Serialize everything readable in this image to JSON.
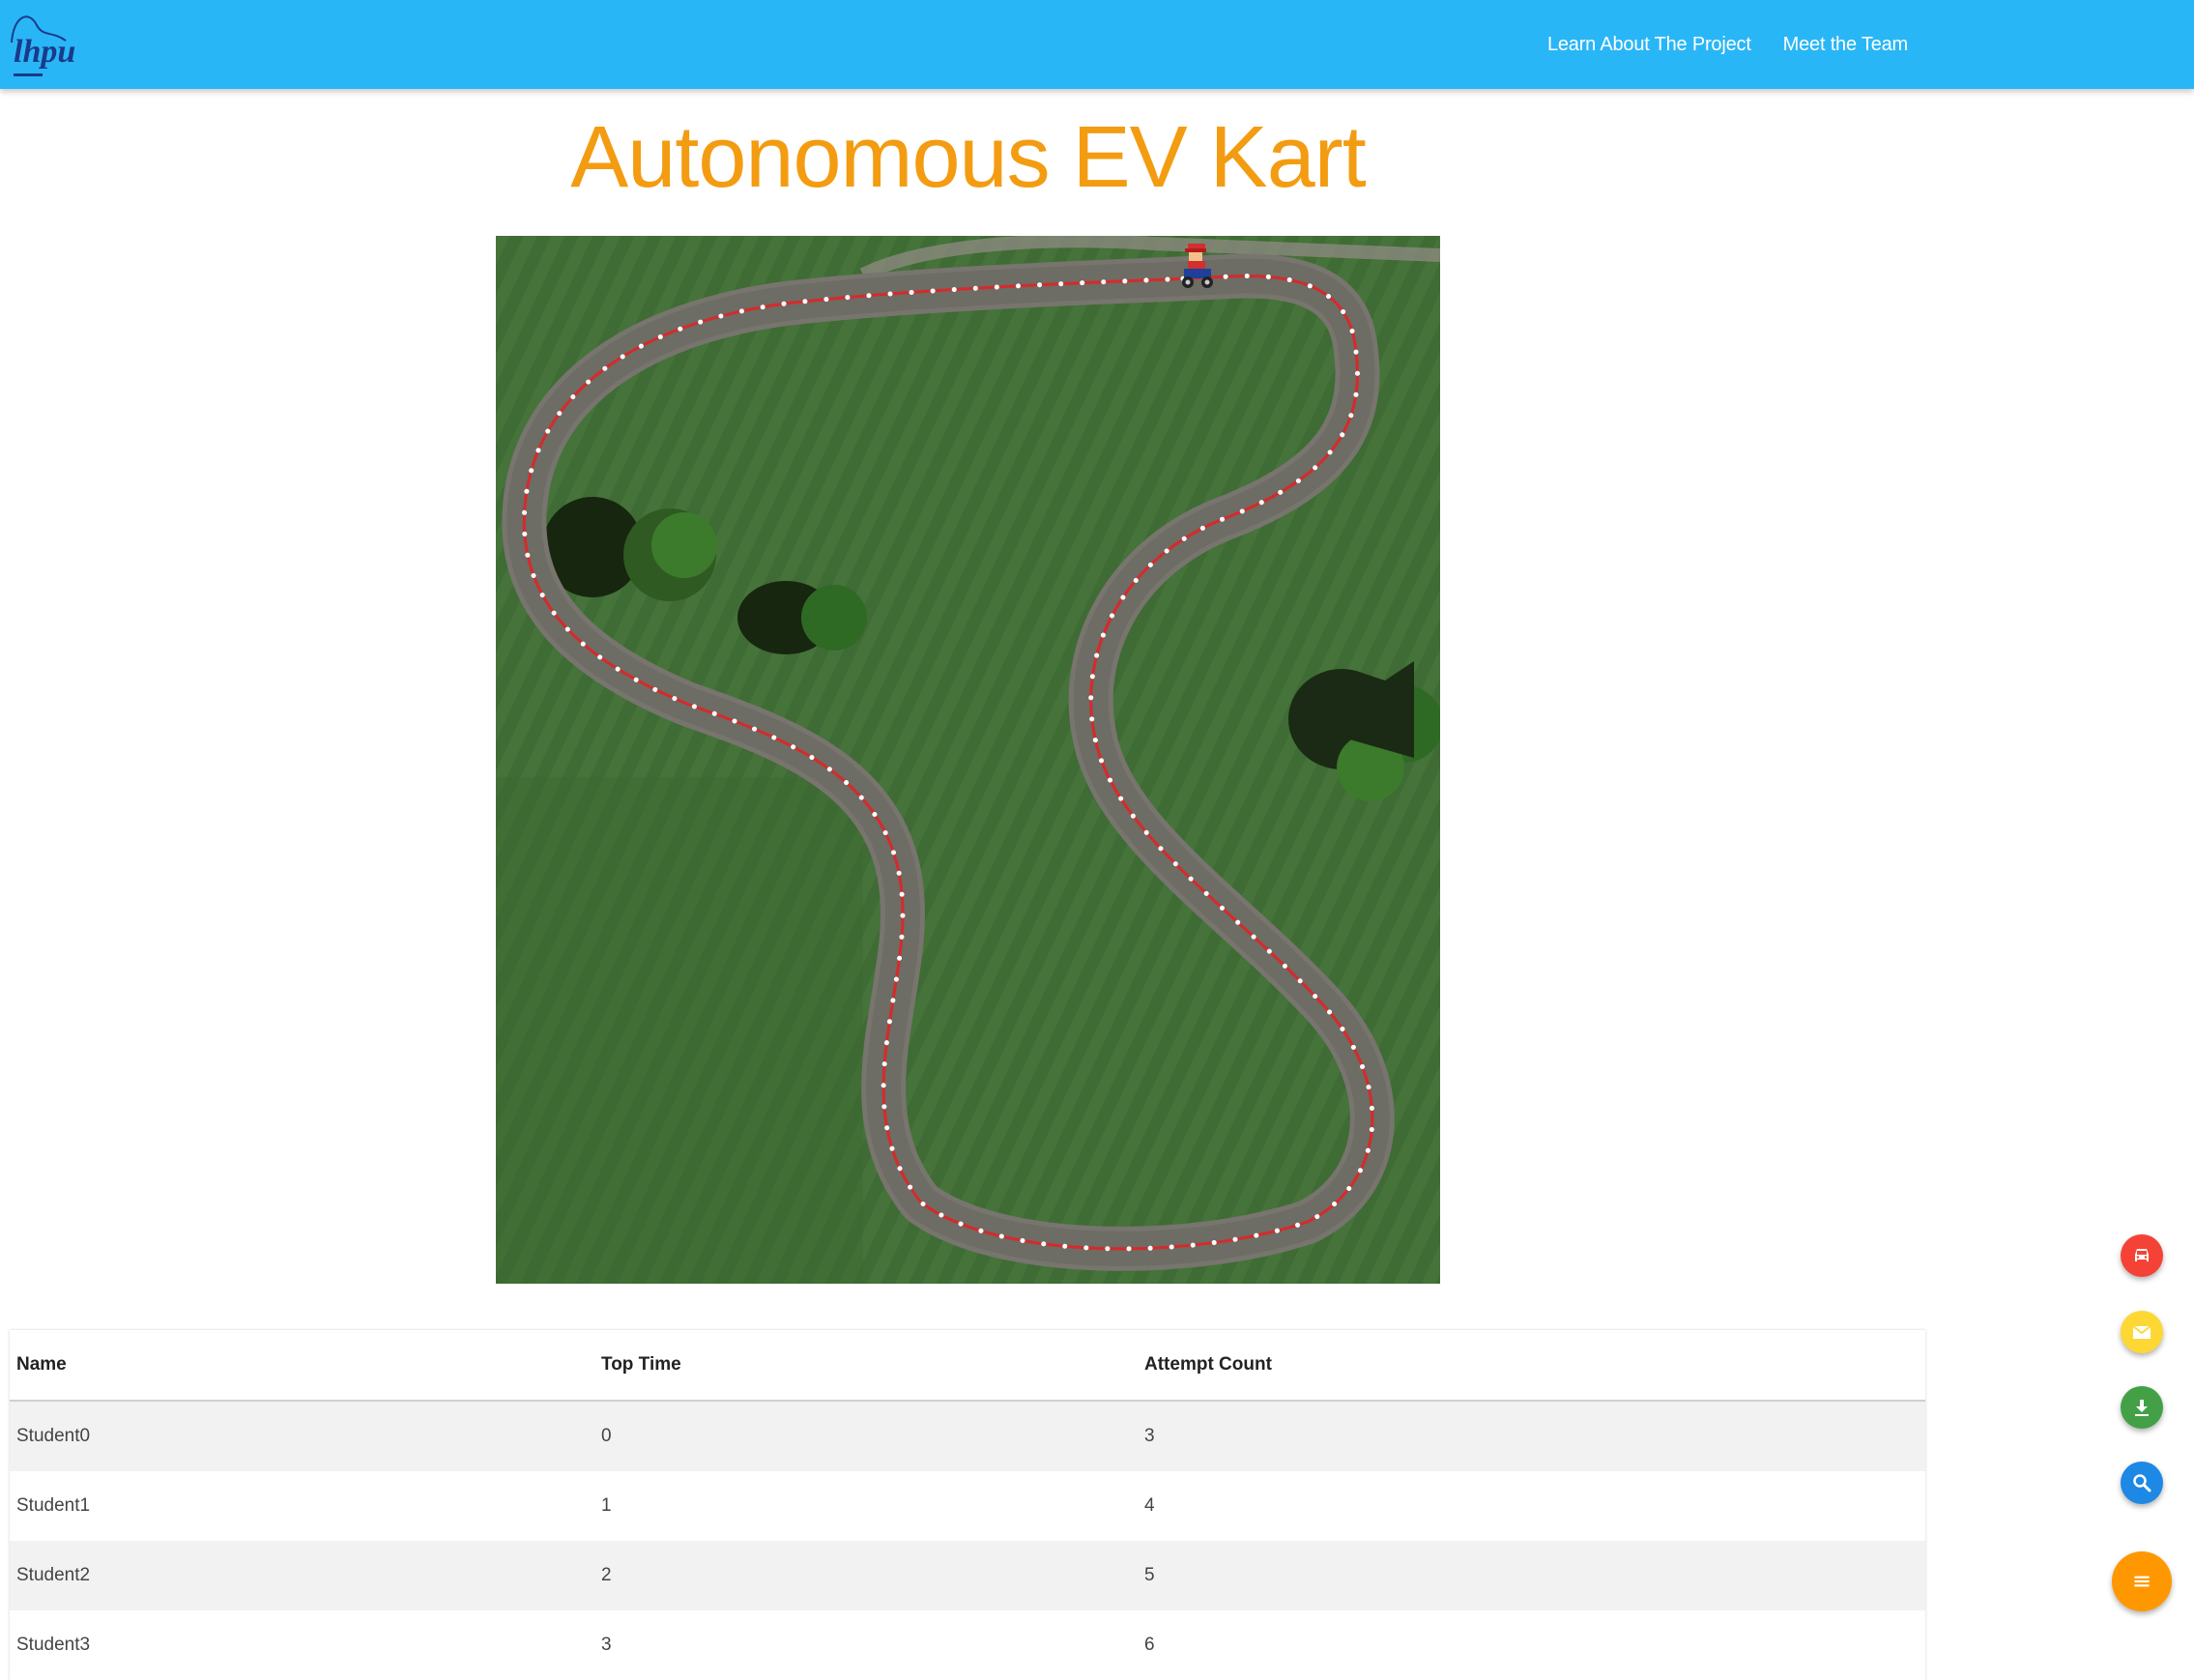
{
  "nav": {
    "logo_text": "lhpu",
    "links": [
      "Learn About The Project",
      "Meet the Team"
    ]
  },
  "title": "Autonomous EV Kart",
  "table": {
    "headers": [
      "Name",
      "Top Time",
      "Attempt Count"
    ],
    "rows": [
      [
        "Student0",
        "0",
        "3"
      ],
      [
        "Student1",
        "1",
        "4"
      ],
      [
        "Student2",
        "2",
        "5"
      ],
      [
        "Student3",
        "3",
        "6"
      ]
    ]
  },
  "fabs": [
    {
      "icon": "car-icon",
      "color": "#f44336"
    },
    {
      "icon": "mail-icon",
      "color": "#fdd835"
    },
    {
      "icon": "download-icon",
      "color": "#43a047"
    },
    {
      "icon": "search-icon",
      "color": "#1e88e5"
    },
    {
      "icon": "menu-icon",
      "color": "#ff9800"
    }
  ],
  "colors": {
    "navbar": "#29b6f6",
    "title": "#f39c12",
    "grass": "#3f6b34",
    "track": "#77756e"
  }
}
